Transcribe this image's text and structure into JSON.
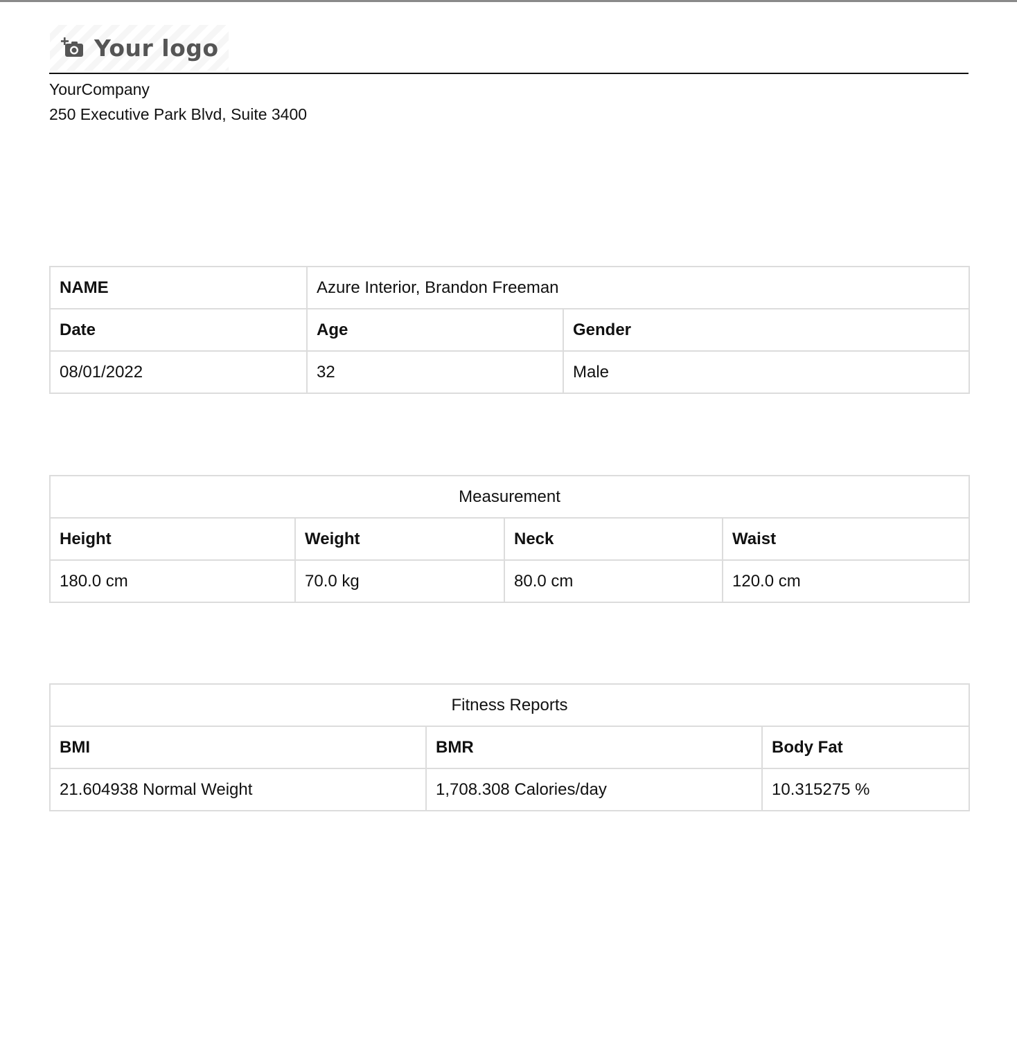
{
  "header": {
    "logo_text": "Your logo",
    "company_name": "YourCompany",
    "company_address": "250 Executive Park Blvd, Suite 3400"
  },
  "info": {
    "name_label": "NAME",
    "name_value": "Azure Interior, Brandon Freeman",
    "date_label": "Date",
    "age_label": "Age",
    "gender_label": "Gender",
    "date_value": "08/01/2022",
    "age_value": "32",
    "gender_value": "Male"
  },
  "measurement": {
    "title": "Measurement",
    "columns": [
      "Height",
      "Weight",
      "Neck",
      "Waist"
    ],
    "values": [
      "180.0 cm",
      "70.0 kg",
      "80.0 cm",
      "120.0 cm"
    ]
  },
  "fitness": {
    "title": "Fitness Reports",
    "columns": [
      "BMI",
      "BMR",
      "Body Fat"
    ],
    "values": [
      "21.604938 Normal Weight",
      "1,708.308 Calories/day",
      "10.315275 %"
    ]
  },
  "icons": {
    "logo": "camera-add-icon"
  },
  "colors": {
    "text": "#111111",
    "border": "#dcdcdc",
    "logo_text": "#555555"
  }
}
